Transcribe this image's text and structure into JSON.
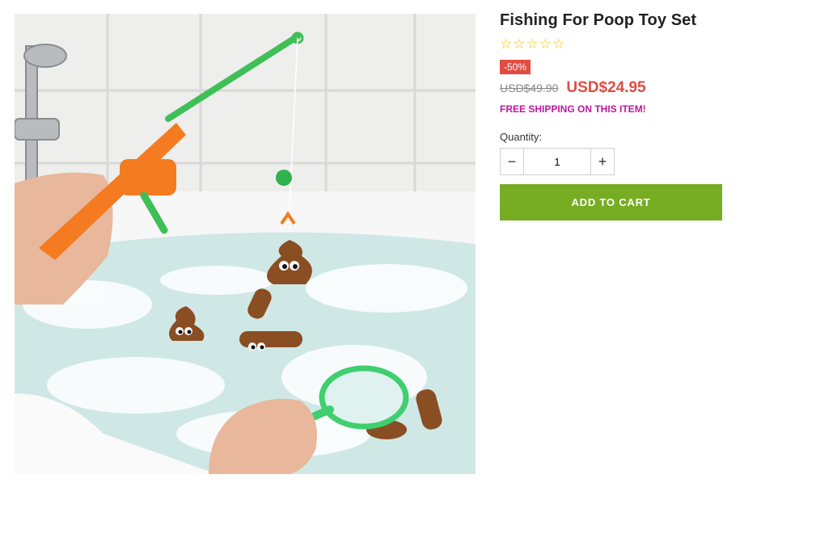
{
  "product": {
    "title": "Fishing For Poop Toy Set",
    "rating_stars": [
      "☆",
      "☆",
      "☆",
      "☆",
      "☆"
    ],
    "discount_badge": "-50%",
    "old_price": "USD$49.90",
    "new_price": "USD$24.95",
    "shipping_note": "FREE SHIPPING ON THIS ITEM!",
    "quantity_label": "Quantity:",
    "quantity_value": "1",
    "decrement_symbol": "−",
    "increment_symbol": "+",
    "add_to_cart_label": "ADD TO CART"
  },
  "colors": {
    "star": "#f3c21a",
    "badge": "#e04c42",
    "price": "#e04c42",
    "shipping": "#c0169f",
    "cart_button": "#76ad23"
  },
  "image": {
    "subject": "product-photo-poop-fishing-toy"
  }
}
